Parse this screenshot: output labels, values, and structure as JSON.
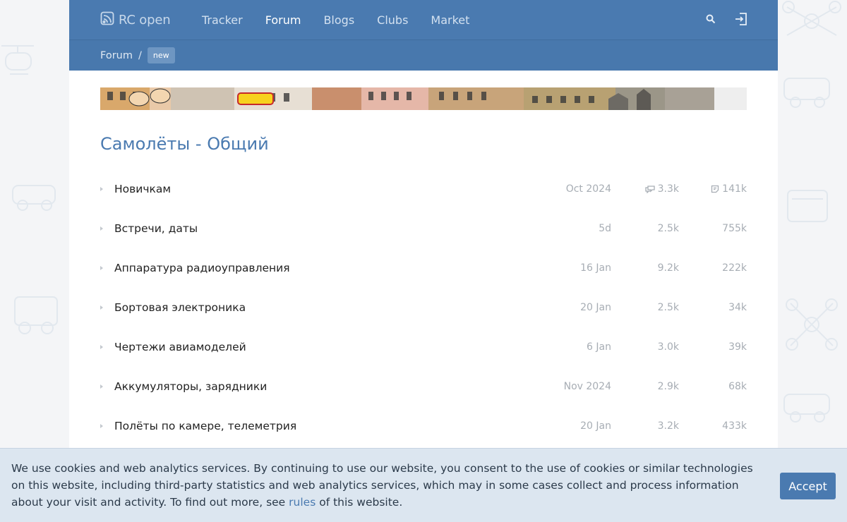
{
  "header": {
    "logo_text": "RC open",
    "nav": [
      {
        "label": "Tracker",
        "active": false
      },
      {
        "label": "Forum",
        "active": true
      },
      {
        "label": "Blogs",
        "active": false
      },
      {
        "label": "Clubs",
        "active": false
      },
      {
        "label": "Market",
        "active": false
      }
    ],
    "icons": [
      "search-icon",
      "login-icon"
    ]
  },
  "breadcrumb": {
    "root": "Forum",
    "separator": "/",
    "badge": "new"
  },
  "category": {
    "title": "Самолёты - Общий"
  },
  "forums": [
    {
      "name": "Новичкам",
      "last": "Oct 2024",
      "topics": "3.3k",
      "posts": "141k"
    },
    {
      "name": "Встречи, даты",
      "last": "5d",
      "topics": "2.5k",
      "posts": "755k"
    },
    {
      "name": "Аппаратура радиоуправления",
      "last": "16 Jan",
      "topics": "9.2k",
      "posts": "222k"
    },
    {
      "name": "Бортовая электроника",
      "last": "20 Jan",
      "topics": "2.5k",
      "posts": "34k"
    },
    {
      "name": "Чертежи авиамоделей",
      "last": "6 Jan",
      "topics": "3.0k",
      "posts": "39k"
    },
    {
      "name": "Аккумуляторы, зарядники",
      "last": "Nov 2024",
      "topics": "2.9k",
      "posts": "68k"
    },
    {
      "name": "Полёты по камере, телеметрия",
      "last": "20 Jan",
      "topics": "3.2k",
      "posts": "433k"
    }
  ],
  "cookie": {
    "text_before": "We use cookies and web analytics services. By continuing to use our website, you consent to the use of cookies or similar technologies on this website, including third-party statistics and web analytics services, which may in some cases collect and process information about your visit and activity. To find out more, see ",
    "link": "rules",
    "text_after": " of this website.",
    "accept_label": "Accept"
  },
  "colors": {
    "header_bg": "#4a7ab0",
    "accent": "#4a7ab0",
    "cookie_bg": "#dce6f0"
  }
}
